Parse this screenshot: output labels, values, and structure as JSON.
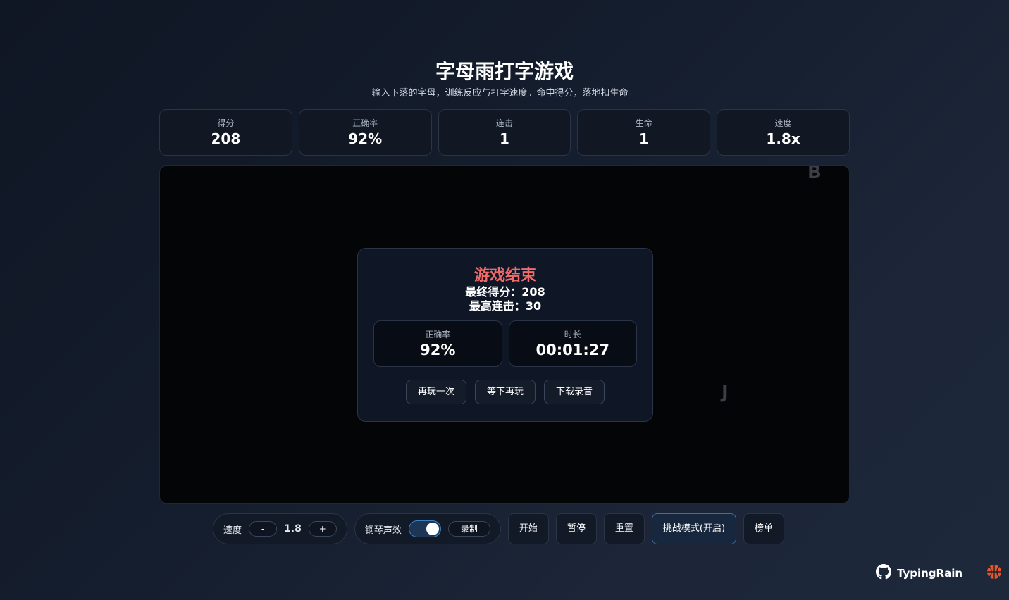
{
  "header": {
    "title": "字母雨打字游戏",
    "subtitle": "输入下落的字母，训练反应与打字速度。命中得分，落地扣生命。"
  },
  "stats": [
    {
      "label": "得分",
      "value": "208"
    },
    {
      "label": "正确率",
      "value": "92%"
    },
    {
      "label": "连击",
      "value": "1"
    },
    {
      "label": "生命",
      "value": "1"
    },
    {
      "label": "速度",
      "value": "1.8x"
    }
  ],
  "arena": {
    "falling_letters": [
      "B",
      "J"
    ]
  },
  "game_over": {
    "title": "游戏结束",
    "final_score": "最终得分：208",
    "max_combo": "最高连击：30",
    "accuracy_label": "正确率",
    "accuracy_value": "92%",
    "duration_label": "时长",
    "duration_value": "00:01:27",
    "buttons": {
      "replay": "再玩一次",
      "later": "等下再玩",
      "download": "下载录音"
    }
  },
  "controls": {
    "speed_label": "速度",
    "speed_minus": "-",
    "speed_value": "1.8",
    "speed_plus": "+",
    "piano_label": "钢琴声效",
    "piano_enabled": true,
    "record": "录制",
    "start": "开始",
    "pause": "暂停",
    "reset": "重置",
    "challenge": "挑战模式(开启)",
    "leaderboard": "榜单"
  },
  "footer": {
    "brand": "TypingRain",
    "icons": [
      "github-icon",
      "basketball-icon"
    ]
  },
  "colors": {
    "accent_red": "#f06a6a",
    "toggle_on": "#3b82c4",
    "basketball": "#e4572e"
  }
}
